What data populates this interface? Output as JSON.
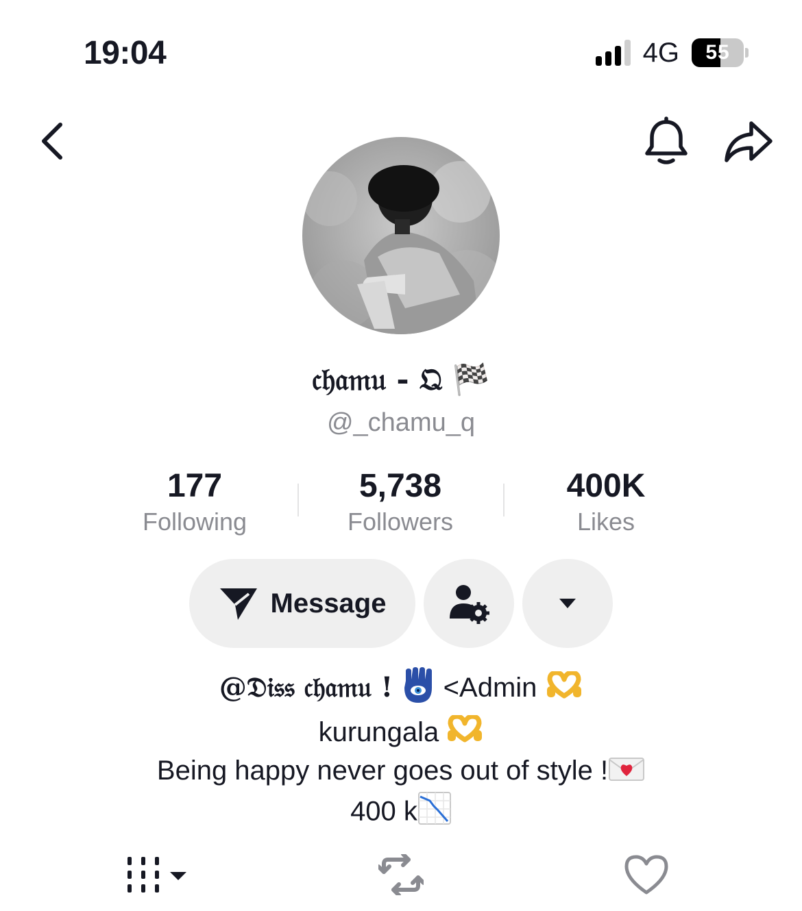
{
  "status_bar": {
    "time": "19:04",
    "network": "4G",
    "battery": "55",
    "battery_level": 0.55
  },
  "nav": {
    "back_icon": "chevron-left-icon",
    "bell_icon": "bell-icon",
    "share_icon": "share-arrow-icon"
  },
  "profile": {
    "display_name": "𝔠𝔥𝔞𝔪𝔲 - 𝔔 🏁",
    "handle": "@_chamu_q"
  },
  "stats": [
    {
      "value": "177",
      "label": "Following"
    },
    {
      "value": "5,738",
      "label": "Followers"
    },
    {
      "value": "400K",
      "label": "Likes"
    }
  ],
  "actions": {
    "message_label": "Message",
    "message_icon": "send-icon",
    "friend_settings_icon": "user-gear-icon",
    "more_icon": "caret-down-icon"
  },
  "bio": {
    "line1_name": "@𝔇𝔦𝔰𝔰 𝔠𝔥𝔞𝔪𝔲 !",
    "line1_rest": "<Admin",
    "line2": "kurungala",
    "line3": "Being happy never goes out of style !",
    "line4": "400 k"
  },
  "tabs": [
    {
      "name": "videos",
      "icon": "grid-filter-icon"
    },
    {
      "name": "reposts",
      "icon": "repost-icon"
    },
    {
      "name": "liked",
      "icon": "heart-icon"
    }
  ],
  "colors": {
    "text": "#161823",
    "secondary_text": "#8a8b91",
    "button_bg": "#efefef",
    "heart_red": "#e0243d",
    "gold": "#f1b52c"
  }
}
